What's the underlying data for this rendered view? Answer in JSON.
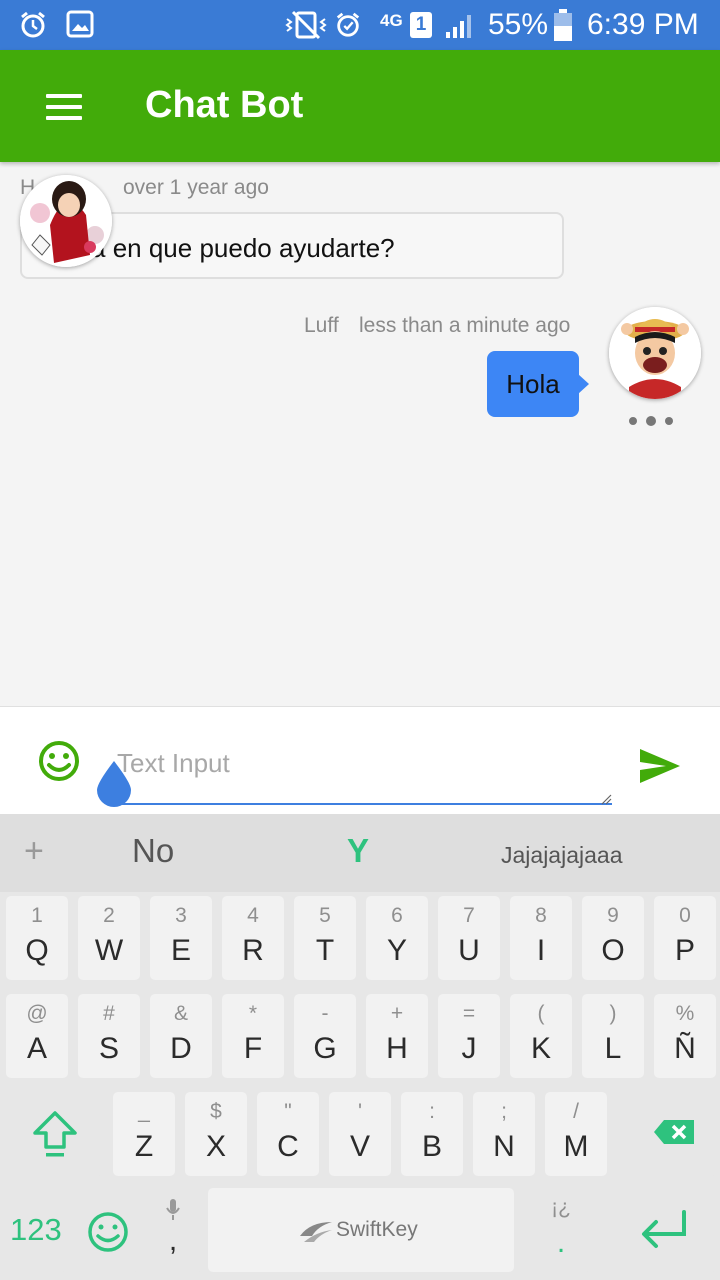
{
  "status_bar": {
    "battery": "55%",
    "time": "6:39 PM",
    "network": "4G",
    "sim": "1"
  },
  "app_bar": {
    "title": "Chat Bot"
  },
  "messages": [
    {
      "author": "H   k",
      "time": "over 1 year ago",
      "text": "Hola en que puedo ayudarte?"
    },
    {
      "author": "Luff",
      "time": "less than a minute ago",
      "text": "Hola"
    }
  ],
  "input": {
    "placeholder": "Text Input"
  },
  "keyboard": {
    "suggestions": [
      "No",
      "Y",
      "Jajajajajaaa"
    ],
    "add_label": "+",
    "row1": [
      {
        "sec": "1",
        "pri": "Q"
      },
      {
        "sec": "2",
        "pri": "W"
      },
      {
        "sec": "3",
        "pri": "E"
      },
      {
        "sec": "4",
        "pri": "R"
      },
      {
        "sec": "5",
        "pri": "T"
      },
      {
        "sec": "6",
        "pri": "Y"
      },
      {
        "sec": "7",
        "pri": "U"
      },
      {
        "sec": "8",
        "pri": "I"
      },
      {
        "sec": "9",
        "pri": "O"
      },
      {
        "sec": "0",
        "pri": "P"
      }
    ],
    "row2": [
      {
        "sec": "@",
        "pri": "A"
      },
      {
        "sec": "#",
        "pri": "S"
      },
      {
        "sec": "&",
        "pri": "D"
      },
      {
        "sec": "*",
        "pri": "F"
      },
      {
        "sec": "-",
        "pri": "G"
      },
      {
        "sec": "+",
        "pri": "H"
      },
      {
        "sec": "=",
        "pri": "J"
      },
      {
        "sec": "(",
        "pri": "K"
      },
      {
        "sec": ")",
        "pri": "L"
      },
      {
        "sec": "%",
        "pri": "Ñ"
      }
    ],
    "row3": [
      {
        "sec": "_",
        "pri": "Z"
      },
      {
        "sec": "$",
        "pri": "X"
      },
      {
        "sec": "\"",
        "pri": "C"
      },
      {
        "sec": "'",
        "pri": "V"
      },
      {
        "sec": ":",
        "pri": "B"
      },
      {
        "sec": ";",
        "pri": "N"
      },
      {
        "sec": "/",
        "pri": "M"
      }
    ],
    "numbers_label": "123",
    "comma": ",",
    "brand": "SwiftKey",
    "period": ".",
    "period_sec": "¡¿"
  },
  "colors": {
    "app_bar": "#42ab0a",
    "status_bar": "#3a7bd5",
    "user_bubble": "#3d86f5",
    "keyboard_accent": "#2ec27e"
  }
}
